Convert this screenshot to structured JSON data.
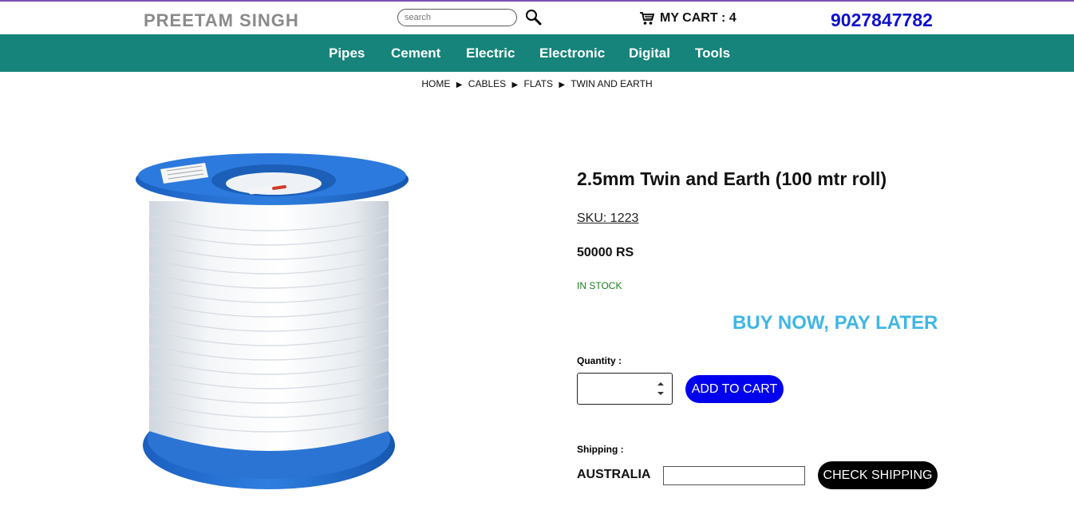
{
  "header": {
    "brand": "PREETAM SINGH",
    "search_placeholder": "search",
    "cart_label": "MY CART : 4",
    "phone": "9027847782"
  },
  "nav": {
    "items": [
      {
        "label": "Pipes"
      },
      {
        "label": "Cement"
      },
      {
        "label": "Electric"
      },
      {
        "label": "Electronic"
      },
      {
        "label": "Digital"
      },
      {
        "label": "Tools"
      }
    ]
  },
  "breadcrumb": [
    "HOME",
    "CABLES",
    "FLATS",
    "TWIN AND EARTH"
  ],
  "product": {
    "title": "2.5mm Twin and Earth (100 mtr roll)",
    "sku": "SKU: 1223",
    "price": "50000 RS",
    "stock": "IN STOCK",
    "promo": "BUY NOW, PAY LATER",
    "quantity_label": "Quantity :",
    "quantity_value": "",
    "add_to_cart": "ADD TO CART",
    "shipping_label": "Shipping :",
    "shipping_country": "AUSTRALIA",
    "check_shipping": "CHECK SHIPPING"
  },
  "colors": {
    "nav_bg": "#16847a",
    "phone": "#1010cc",
    "promo": "#3fb6e6",
    "add_to_cart_bg": "#0000ee",
    "stock": "#1e7b1e"
  },
  "icons": {
    "search": "magnifier-icon",
    "cart": "shopping-cart-icon",
    "breadcrumb_separator": "triangle-right-icon"
  }
}
